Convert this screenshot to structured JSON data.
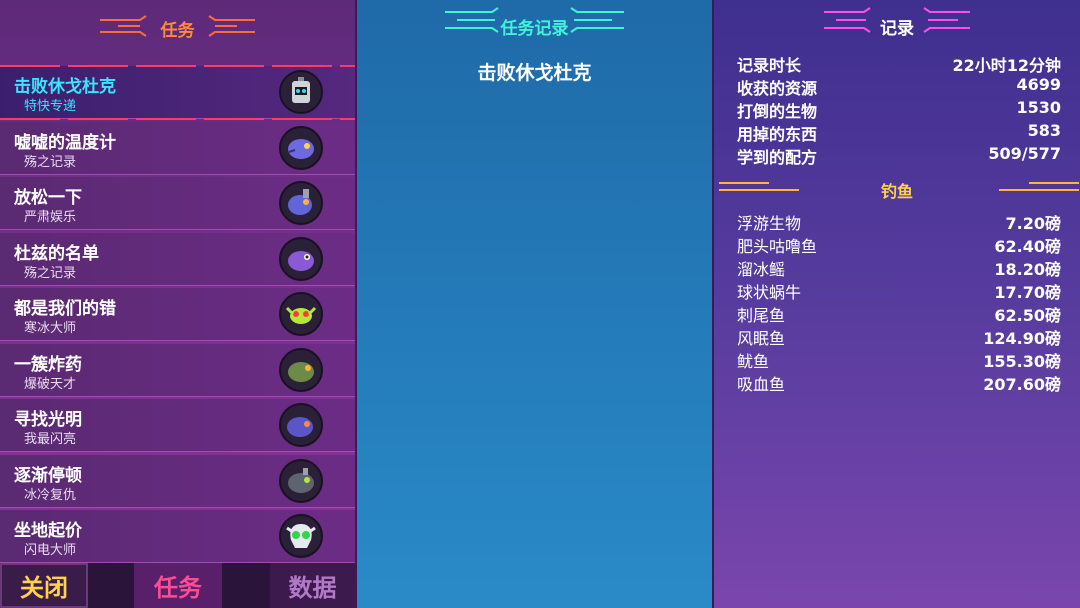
{
  "left_panel": {
    "title": "任务",
    "quests": [
      {
        "name": "击败休戈杜克",
        "sub": "特快专递",
        "icon": "robot-icon"
      },
      {
        "name": "嘘嘘的温度计",
        "sub": "殇之记录",
        "icon": "purple-fish-icon"
      },
      {
        "name": "放松一下",
        "sub": "严肃娱乐",
        "icon": "drill-fish-icon"
      },
      {
        "name": "杜兹的名单",
        "sub": "殇之记录",
        "icon": "purple-blob-icon"
      },
      {
        "name": "都是我们的错",
        "sub": "寒冰大师",
        "icon": "green-crab-icon"
      },
      {
        "name": "一簇炸药",
        "sub": "爆破天才",
        "icon": "green-fish-icon"
      },
      {
        "name": "寻找光明",
        "sub": "我最闪亮",
        "icon": "blue-fish-icon"
      },
      {
        "name": "逐渐停顿",
        "sub": "冰冷复仇",
        "icon": "armored-fish-icon"
      },
      {
        "name": "坐地起价",
        "sub": "闪电大师",
        "icon": "skull-icon"
      }
    ],
    "tabs": {
      "close": "关闭",
      "quest": "任务",
      "data": "数据"
    }
  },
  "center_panel": {
    "title": "任务记录",
    "subtitle": "击败休戈杜克"
  },
  "right_panel": {
    "title": "记录",
    "stats": [
      {
        "label": "记录时长",
        "value": "22小时12分钟"
      },
      {
        "label": "收获的资源",
        "value": "4699"
      },
      {
        "label": "打倒的生物",
        "value": "1530"
      },
      {
        "label": "用掉的东西",
        "value": "583"
      },
      {
        "label": "学到的配方",
        "value": "509/577"
      }
    ],
    "fishing_title": "钓鱼",
    "fish": [
      {
        "label": "浮游生物",
        "value": "7.20磅"
      },
      {
        "label": "肥头咕噜鱼",
        "value": "62.40磅"
      },
      {
        "label": "溜冰鳐",
        "value": "18.20磅"
      },
      {
        "label": "球状蜗牛",
        "value": "17.70磅"
      },
      {
        "label": "刺尾鱼",
        "value": "62.50磅"
      },
      {
        "label": "风眠鱼",
        "value": "124.90磅"
      },
      {
        "label": "鱿鱼",
        "value": "155.30磅"
      },
      {
        "label": "吸血鱼",
        "value": "207.60磅"
      }
    ]
  },
  "colors": {
    "left_title": "#ff8a3a",
    "center_title": "#41f2d8",
    "right_title": "#ff4df0",
    "active_quest": "#38e6ff",
    "fishing": "#ffd24a"
  }
}
